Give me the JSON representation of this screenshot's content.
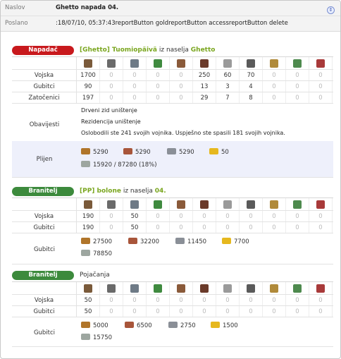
{
  "header": {
    "subject_label": "Naslov",
    "subject": "Ghetto napada 04.",
    "sent_label": "Poslano",
    "sent": ":18/07/10, 05:37:43reportButton goldreportButton accessreportButton delete"
  },
  "attacker": {
    "role": "Napadač",
    "player": "[Ghetto] Tuomiopäivä",
    "from_text": "iz naselja",
    "village": "Ghetto",
    "unit_icons": [
      "club-icon",
      "spear-icon",
      "axe-icon",
      "scout-icon",
      "paladin-icon",
      "teutonic-knight-icon",
      "ram-icon",
      "catapult-icon",
      "chief-icon",
      "settler-icon",
      "hero-icon"
    ],
    "rows": [
      {
        "label": "Vojska",
        "values": [
          "1700",
          "0",
          "0",
          "0",
          "0",
          "250",
          "60",
          "70",
          "0",
          "0",
          "0"
        ]
      },
      {
        "label": "Gubitci",
        "values": [
          "90",
          "0",
          "0",
          "0",
          "0",
          "13",
          "3",
          "4",
          "0",
          "0",
          "0"
        ]
      },
      {
        "label": "Zatočenici",
        "values": [
          "197",
          "0",
          "0",
          "0",
          "0",
          "29",
          "7",
          "8",
          "0",
          "0",
          "0"
        ]
      }
    ],
    "info_label": "Obavijesti",
    "info": [
      "Drveni zid uništenje",
      "Rezidencija uništenje",
      "Oslobodili ste 241 svojih vojnika. Uspješno ste spasili 181 svojih vojnika."
    ],
    "loot_label": "Plijen",
    "loot": {
      "wood": "5290",
      "clay": "5290",
      "iron": "5290",
      "crop": "50",
      "carry": "15920 / 87280 (18%)"
    }
  },
  "defender1": {
    "role": "Branitelj",
    "player": "[PP] bolone",
    "from_text": "iz naselja",
    "village": "04.",
    "unit_icons": [
      "spear-icon",
      "sword-icon",
      "pathfinder-icon",
      "haeduan-icon",
      "theutates-thunder-icon",
      "druidrider-icon",
      "ram-icon",
      "trebuchet-icon",
      "chieftain-icon",
      "settler-icon",
      "hero-icon"
    ],
    "rows": [
      {
        "label": "Vojska",
        "values": [
          "190",
          "0",
          "50",
          "0",
          "0",
          "0",
          "0",
          "0",
          "0",
          "0",
          "0"
        ]
      },
      {
        "label": "Gubitci",
        "values": [
          "190",
          "0",
          "50",
          "0",
          "0",
          "0",
          "0",
          "0",
          "0",
          "0",
          "0"
        ]
      }
    ],
    "loss_label": "Gubitci",
    "losses": {
      "wood": "27500",
      "clay": "32200",
      "iron": "11450",
      "crop": "7700",
      "total": "78850"
    }
  },
  "defender2": {
    "role": "Branitelj",
    "title": "Pojačanja",
    "unit_icons": [
      "spear-icon",
      "sword-icon",
      "pathfinder-icon",
      "haeduan-icon",
      "theutates-thunder-icon",
      "druidrider-icon",
      "ram-icon",
      "trebuchet-icon",
      "chieftain-icon",
      "settler-icon",
      "hero-icon"
    ],
    "rows": [
      {
        "label": "Vojska",
        "values": [
          "50",
          "0",
          "0",
          "0",
          "0",
          "0",
          "0",
          "0",
          "0",
          "0",
          "0"
        ]
      },
      {
        "label": "Gubitci",
        "values": [
          "50",
          "0",
          "0",
          "0",
          "0",
          "0",
          "0",
          "0",
          "0",
          "0",
          "0"
        ]
      }
    ],
    "loss_label": "Gubitci",
    "losses": {
      "wood": "5000",
      "clay": "6500",
      "iron": "2750",
      "crop": "1500",
      "total": "15750"
    }
  },
  "colors": {
    "attacker": "#c8191d",
    "defender": "#3c8a3c",
    "highlight": "#7aa61f",
    "band": "#eef0fb"
  }
}
